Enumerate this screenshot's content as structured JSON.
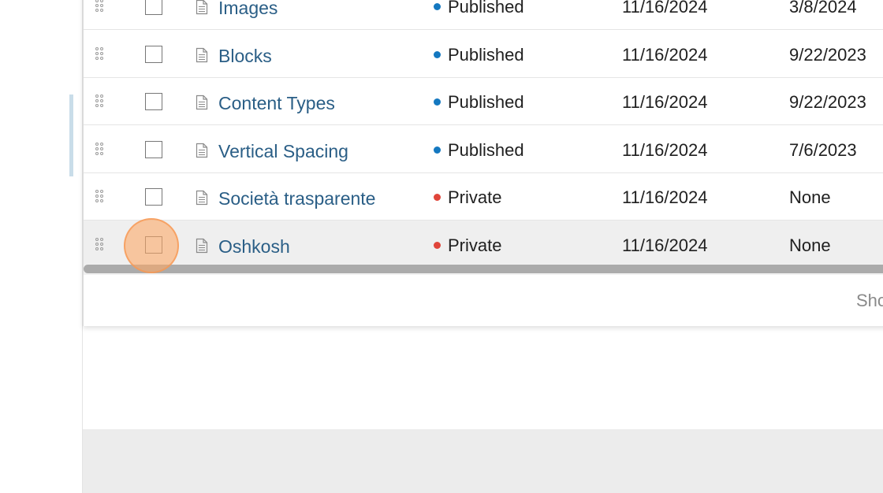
{
  "table": {
    "rows": [
      {
        "title": "Images",
        "status": "Published",
        "status_color": "#1478c0",
        "date_created": "11/16/2024",
        "date_modified": "3/8/2024"
      },
      {
        "title": "Blocks",
        "status": "Published",
        "status_color": "#1478c0",
        "date_created": "11/16/2024",
        "date_modified": "9/22/2023"
      },
      {
        "title": "Content Types",
        "status": "Published",
        "status_color": "#1478c0",
        "date_created": "11/16/2024",
        "date_modified": "9/22/2023"
      },
      {
        "title": "Vertical Spacing",
        "status": "Published",
        "status_color": "#1478c0",
        "date_created": "11/16/2024",
        "date_modified": "7/6/2023"
      },
      {
        "title": "Società trasparente",
        "status": "Private",
        "status_color": "#e0453a",
        "date_created": "11/16/2024",
        "date_modified": "None"
      },
      {
        "title": "Oshkosh",
        "status": "Private",
        "status_color": "#e0453a",
        "date_created": "11/16/2024",
        "date_modified": "None"
      }
    ],
    "hovered_row": 5
  },
  "footer": {
    "text": "Sho"
  },
  "icons": {
    "drag": "drag-handle-icon",
    "document": "document-icon"
  }
}
